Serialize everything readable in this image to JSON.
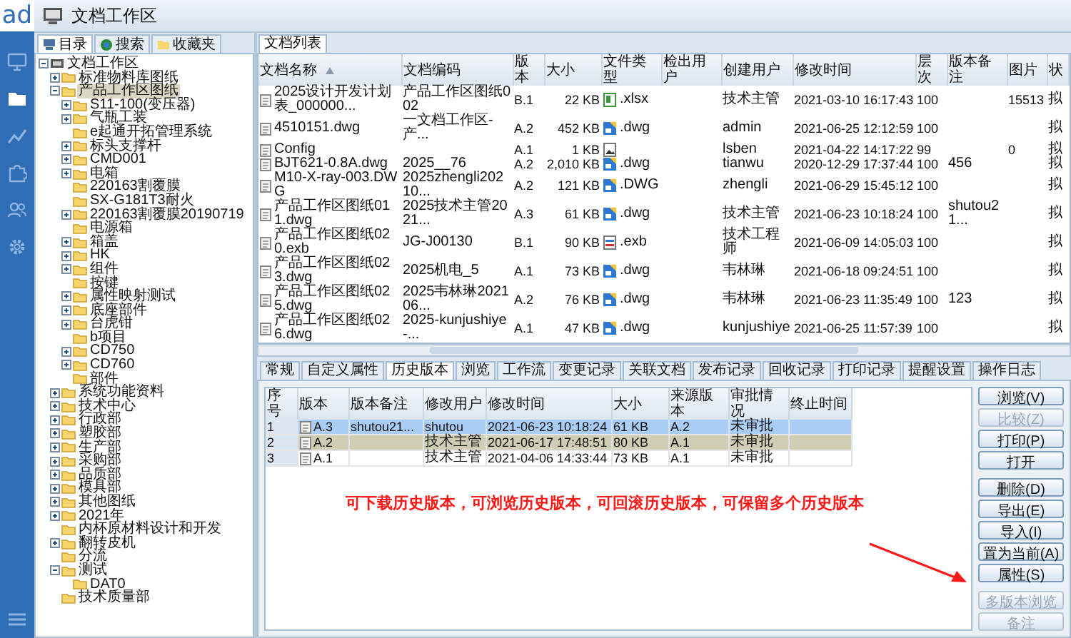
{
  "app": {
    "logo": "ad",
    "title": "文档工作区"
  },
  "sidebar": {
    "items": [
      {
        "selected": false
      },
      {
        "selected": true
      },
      {
        "selected": false
      },
      {
        "selected": false
      },
      {
        "selected": false
      },
      {
        "selected": false
      }
    ]
  },
  "left_tabs": [
    {
      "label": "目录",
      "selected": true
    },
    {
      "label": "搜索",
      "selected": false
    },
    {
      "label": "收藏夹",
      "selected": false
    }
  ],
  "tree": [
    {
      "label": "文档工作区",
      "selected": false,
      "expanded": true,
      "children": [
        {
          "label": "标准物料库图纸",
          "selected": false,
          "expanded": false
        },
        {
          "label": "产品工作区图纸",
          "selected": true,
          "expanded": true,
          "children": [
            {
              "label": "S11-100(变压器)",
              "selected": false,
              "expanded": false
            },
            {
              "label": "气瓶工装",
              "selected": false,
              "expanded": false
            },
            {
              "label": "e起通开拓管理系统",
              "selected": false
            },
            {
              "label": "标头支撑杆",
              "selected": false,
              "expanded": false
            },
            {
              "label": "CMD001",
              "selected": false,
              "expanded": false
            },
            {
              "label": "电箱",
              "selected": false,
              "expanded": false
            },
            {
              "label": "220163割覆膜",
              "selected": false
            },
            {
              "label": "SX-G181T3耐火",
              "selected": false
            },
            {
              "label": "220163割覆膜20190719",
              "selected": false,
              "expanded": false
            },
            {
              "label": "电源箱",
              "selected": false
            },
            {
              "label": "箱盖",
              "selected": false,
              "expanded": false
            },
            {
              "label": "HK",
              "selected": false,
              "expanded": false
            },
            {
              "label": "组件",
              "selected": false,
              "expanded": false
            },
            {
              "label": "按键",
              "selected": false
            },
            {
              "label": "属性映射测试",
              "selected": false,
              "expanded": false
            },
            {
              "label": "底座部件",
              "selected": false,
              "expanded": false
            },
            {
              "label": "台虎钳",
              "selected": false,
              "expanded": false
            },
            {
              "label": "b项目",
              "selected": false
            },
            {
              "label": "CD750",
              "selected": false,
              "expanded": false
            },
            {
              "label": "CD760",
              "selected": false,
              "expanded": false
            },
            {
              "label": "部件",
              "selected": false
            }
          ]
        },
        {
          "label": "系统功能资料",
          "selected": false,
          "expanded": false
        },
        {
          "label": "技术中心",
          "selected": false,
          "expanded": false
        },
        {
          "label": "行政部",
          "selected": false,
          "expanded": false
        },
        {
          "label": "塑胶部",
          "selected": false,
          "expanded": false
        },
        {
          "label": "生产部",
          "selected": false,
          "expanded": false
        },
        {
          "label": "采购部",
          "selected": false,
          "expanded": false
        },
        {
          "label": "品质部",
          "selected": false,
          "expanded": false
        },
        {
          "label": "模具部",
          "selected": false,
          "expanded": false
        },
        {
          "label": "其他图纸",
          "selected": false,
          "expanded": false
        },
        {
          "label": "2021年",
          "selected": false,
          "expanded": false
        },
        {
          "label": "内杯原材料设计和开发",
          "selected": false
        },
        {
          "label": "翻转皮机",
          "selected": false,
          "expanded": false
        },
        {
          "label": "分流",
          "selected": false
        },
        {
          "label": "测试",
          "selected": false,
          "expanded": true,
          "children": [
            {
              "label": "DAT0",
              "selected": false
            }
          ]
        },
        {
          "label": "技术质量部",
          "selected": false
        }
      ]
    }
  ],
  "file_list": {
    "tab": "文档列表",
    "columns": [
      {
        "label": "文档名称",
        "sorted": true
      },
      {
        "label": "文档编码"
      },
      {
        "label": "版本"
      },
      {
        "label": "大小"
      },
      {
        "label": "文件类型"
      },
      {
        "label": "检出用户"
      },
      {
        "label": "创建用户"
      },
      {
        "label": "修改时间"
      },
      {
        "label": "层次"
      },
      {
        "label": "版本备注"
      },
      {
        "label": "图片"
      },
      {
        "label": "状"
      }
    ],
    "rows": [
      {
        "kind": "excel",
        "cells": [
          "2025设计开发计划表_000000...",
          "产品工作区图纸002",
          "B.1",
          "22 KB",
          ".xlsx",
          null,
          "技术主管",
          "2021-03-10 16:17:43",
          "100",
          null,
          "15513",
          "拟"
        ]
      },
      {
        "kind": "cad",
        "cells": [
          "4510151.dwg",
          "一文档工作区-产...",
          "A.2",
          "452 KB",
          ".dwg",
          null,
          "admin",
          "2021-06-25 12:12:59",
          "100",
          null,
          null,
          "拟"
        ]
      },
      {
        "kind": "image",
        "cells": [
          "Config",
          null,
          "A.1",
          "1 KB",
          null,
          null,
          "lsben",
          "2021-04-22 14:17:22",
          "99",
          null,
          "0",
          "拟"
        ]
      },
      {
        "kind": "cad",
        "cells": [
          "BJT621-0.8A.dwg",
          "2025__76",
          "A.2",
          "2,010 KB",
          ".dwg",
          null,
          "tianwu",
          "2020-12-29 17:37:44",
          "100",
          "456",
          null,
          "拟"
        ]
      },
      {
        "kind": "cad",
        "cells": [
          "M10-X-ray-003.DWG",
          "2025zhengli20210...",
          "A.2",
          "121 KB",
          ".DWG",
          null,
          "zhengli",
          "2021-06-29 15:45:12",
          "100",
          null,
          null,
          "拟"
        ]
      },
      {
        "kind": "cad",
        "cells": [
          "产品工作区图纸011.dwg",
          "2025技术主管2021...",
          "A.3",
          "61 KB",
          ".dwg",
          null,
          "技术主管",
          "2021-06-23 10:18:24",
          "100",
          "shutou21...",
          null,
          "拟"
        ]
      },
      {
        "kind": "exb",
        "cells": [
          "产品工作区图纸020.exb",
          "JG-J00130",
          "B.1",
          "90 KB",
          ".exb",
          null,
          "技术工程师",
          "2021-06-09 14:05:03",
          "100",
          null,
          null,
          "拟"
        ]
      },
      {
        "kind": "cad",
        "cells": [
          "产品工作区图纸023.dwg",
          "2025机电_5",
          "A.1",
          "73 KB",
          ".dwg",
          null,
          "韦林琳",
          "2021-06-18 09:24:51",
          "100",
          null,
          null,
          "拟"
        ]
      },
      {
        "kind": "cad",
        "cells": [
          "产品工作区图纸025.dwg",
          "2025韦林琳202106...",
          "A.2",
          "76 KB",
          ".dwg",
          null,
          "韦林琳",
          "2021-06-23 11:35:49",
          "100",
          "123",
          null,
          "拟"
        ]
      },
      {
        "kind": "cad",
        "cells": [
          "产品工作区图纸026.dwg",
          "2025-kunjushiye-...",
          "A.1",
          "47 KB",
          ".dwg",
          null,
          "kunjushiye",
          "2021-06-25 11:57:39",
          "100",
          null,
          null,
          "拟"
        ]
      }
    ]
  },
  "detail_tabs": [
    {
      "label": "常规",
      "selected": false
    },
    {
      "label": "自定义属性",
      "selected": false
    },
    {
      "label": "历史版本",
      "selected": true
    },
    {
      "label": "浏览",
      "selected": false
    },
    {
      "label": "工作流",
      "selected": false
    },
    {
      "label": "变更记录",
      "selected": false
    },
    {
      "label": "关联文档",
      "selected": false
    },
    {
      "label": "发布记录",
      "selected": false
    },
    {
      "label": "回收记录",
      "selected": false
    },
    {
      "label": "打印记录",
      "selected": false
    },
    {
      "label": "提醒设置",
      "selected": false
    },
    {
      "label": "操作日志",
      "selected": false
    }
  ],
  "history": {
    "columns": [
      "序号",
      "版本",
      "版本备注",
      "修改用户",
      "修改时间",
      "大小",
      "来源版本",
      "审批情况",
      "终止时间"
    ],
    "rows": [
      {
        "selected": true,
        "current": false,
        "cells": [
          "1",
          "A.3",
          "shutou21...",
          "shutou",
          "2021-06-23 10:18:24",
          "61 KB",
          "A.2",
          "未审批",
          null
        ]
      },
      {
        "selected": false,
        "current": true,
        "cells": [
          "2",
          "A.2",
          null,
          "技术主管",
          "2021-06-17 17:48:51",
          "80 KB",
          "A.1",
          "未审批",
          null
        ]
      },
      {
        "selected": false,
        "current": false,
        "cells": [
          "3",
          "A.1",
          null,
          "技术主管",
          "2021-04-06 14:33:44",
          "73 KB",
          "A.1",
          "未审批",
          null
        ]
      }
    ]
  },
  "annotation": "可下载历史版本，可浏览历史版本，可回滚历史版本，可保留多个历史版本",
  "buttons": [
    {
      "label": "浏览(V)",
      "disabled": false
    },
    {
      "label": "比较(Z)",
      "disabled": true
    },
    {
      "label": "打印(P)",
      "disabled": false
    },
    {
      "label": "打开",
      "disabled": false
    },
    {
      "label": "删除(D)",
      "disabled": false
    },
    {
      "label": "导出(E)",
      "disabled": false
    },
    {
      "label": "导入(I)",
      "disabled": false
    },
    {
      "label": "置为当前(A)",
      "disabled": false
    },
    {
      "label": "属性(S)",
      "disabled": false
    },
    {
      "label": "多版本浏览",
      "disabled": true
    },
    {
      "label": "备注",
      "disabled": true
    }
  ]
}
